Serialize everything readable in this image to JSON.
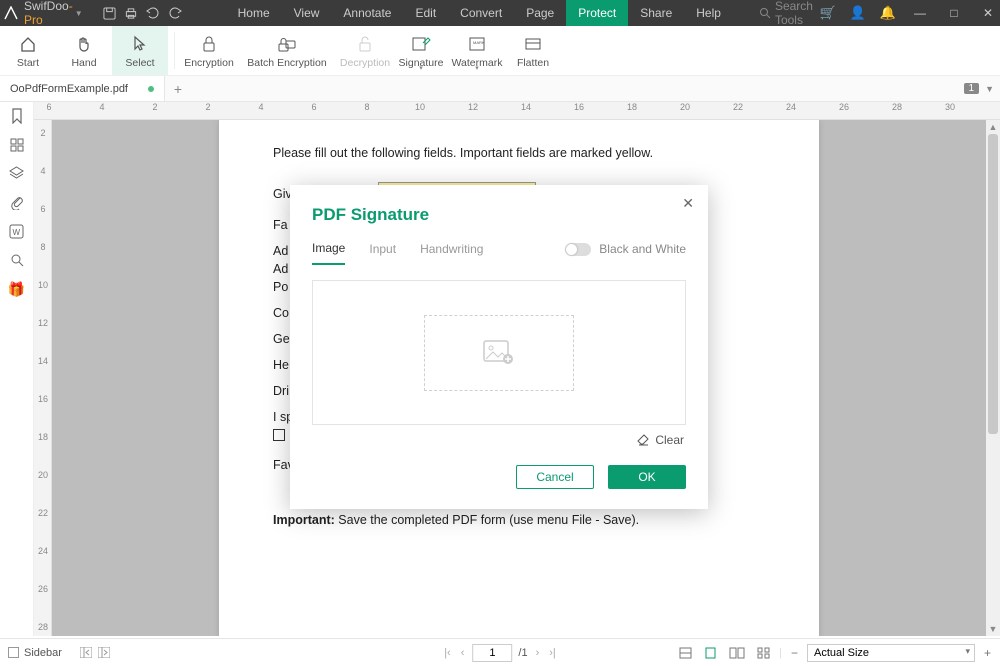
{
  "app": {
    "name_prefix": "Swif",
    "name_mid": "Doo",
    "name_suffix": "-Pro"
  },
  "titlemenu": {
    "home": "Home",
    "view": "View",
    "annotate": "Annotate",
    "edit": "Edit",
    "convert": "Convert",
    "page": "Page",
    "protect": "Protect",
    "share": "Share",
    "help": "Help"
  },
  "title_search_placeholder": "Search Tools",
  "ribbon": {
    "start": "Start",
    "hand": "Hand",
    "select": "Select",
    "encryption": "Encryption",
    "batch_encryption": "Batch Encryption",
    "decryption": "Decryption",
    "signature": "Signature",
    "watermark": "Watermark",
    "flatten": "Flatten"
  },
  "tab_name": "OoPdfFormExample.pdf",
  "tab_pages_badge": "1",
  "doc": {
    "intro": "Please fill out the following fields. Important fields are marked yellow.",
    "given_name": "Given Name:",
    "fa": "Fa",
    "ad1": "Ad",
    "ad2": "Ad",
    "po": "Po",
    "co": "Co",
    "ge": "Ge",
    "he": "He",
    "dri": "Dri",
    "isp": "I sp",
    "fav": "Favourite colour:",
    "important_label": "Important:",
    "important_text": " Save the completed PDF form (use menu File - Save)."
  },
  "modal": {
    "title": "PDF Signature",
    "tab_image": "Image",
    "tab_input": "Input",
    "tab_hand": "Handwriting",
    "bw": "Black and White",
    "clear": "Clear",
    "cancel": "Cancel",
    "ok": "OK"
  },
  "status": {
    "sidebar": "Sidebar",
    "page_current": "1",
    "page_sep": "/1",
    "zoom": "Actual Size"
  },
  "ruler_labels": [
    "6",
    "4",
    "2",
    "2",
    "4",
    "6",
    "8",
    "10",
    "12",
    "14",
    "16",
    "18",
    "20",
    "22",
    "24",
    "26",
    "28",
    "30"
  ],
  "vruler_labels": [
    "2",
    "4",
    "6",
    "8",
    "10",
    "12",
    "14",
    "16",
    "18",
    "20",
    "22",
    "24",
    "26",
    "28"
  ]
}
